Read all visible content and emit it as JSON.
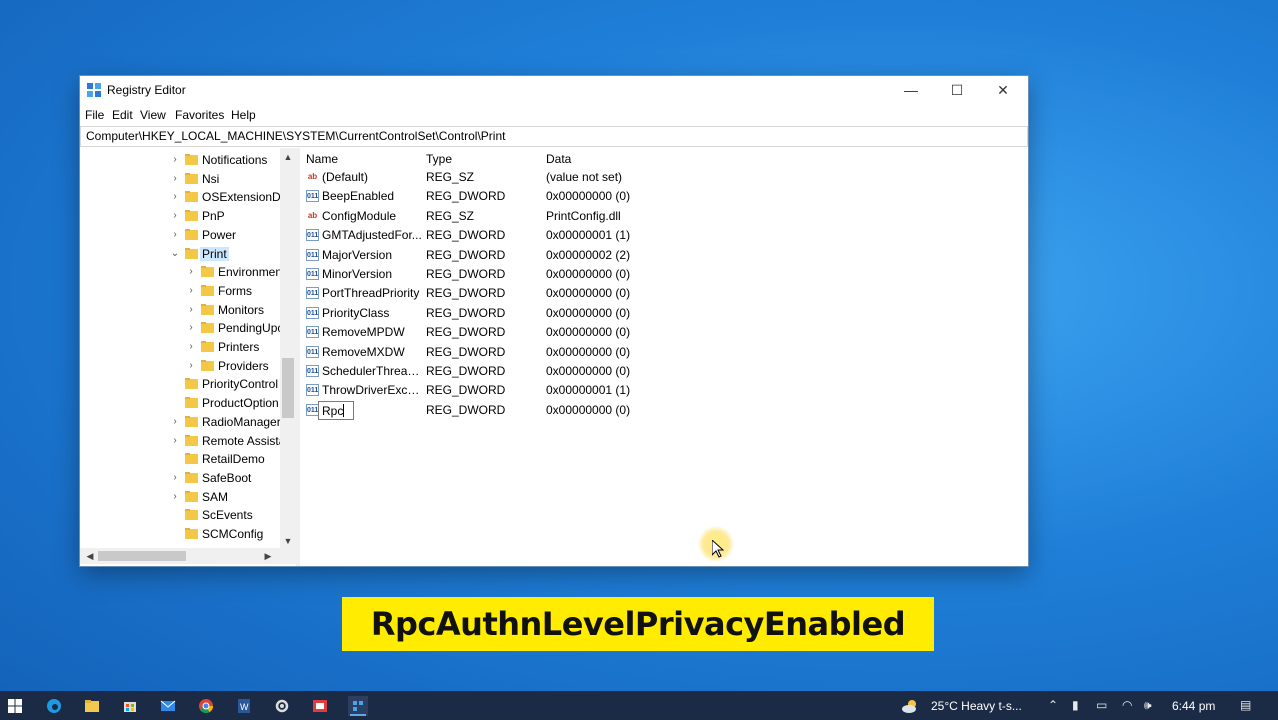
{
  "window": {
    "title": "Registry Editor",
    "controls": {
      "minimize": "—",
      "maximize": "☐",
      "close": "✕"
    }
  },
  "menu": [
    "File",
    "Edit",
    "View",
    "Favorites",
    "Help"
  ],
  "address": "Computer\\HKEY_LOCAL_MACHINE\\SYSTEM\\CurrentControlSet\\Control\\Print",
  "tree": [
    {
      "label": "Notifications",
      "expandable": true,
      "level": 0
    },
    {
      "label": "Nsi",
      "expandable": true,
      "level": 0
    },
    {
      "label": "OSExtensionDa",
      "expandable": true,
      "level": 0
    },
    {
      "label": "PnP",
      "expandable": true,
      "level": 0
    },
    {
      "label": "Power",
      "expandable": true,
      "level": 0
    },
    {
      "label": "Print",
      "expandable": true,
      "expanded": true,
      "selected": true,
      "level": 0
    },
    {
      "label": "Environmen",
      "expandable": true,
      "level": 1
    },
    {
      "label": "Forms",
      "expandable": true,
      "level": 1
    },
    {
      "label": "Monitors",
      "expandable": true,
      "level": 1
    },
    {
      "label": "PendingUpc",
      "expandable": true,
      "level": 1
    },
    {
      "label": "Printers",
      "expandable": true,
      "level": 1
    },
    {
      "label": "Providers",
      "expandable": true,
      "level": 1
    },
    {
      "label": "PriorityControl",
      "expandable": false,
      "level": 0
    },
    {
      "label": "ProductOption",
      "expandable": false,
      "level": 0
    },
    {
      "label": "RadioManager",
      "expandable": true,
      "level": 0
    },
    {
      "label": "Remote Assista",
      "expandable": true,
      "level": 0
    },
    {
      "label": "RetailDemo",
      "expandable": false,
      "level": 0
    },
    {
      "label": "SafeBoot",
      "expandable": true,
      "level": 0
    },
    {
      "label": "SAM",
      "expandable": true,
      "level": 0
    },
    {
      "label": "ScEvents",
      "expandable": false,
      "level": 0
    },
    {
      "label": "SCMConfig",
      "expandable": false,
      "level": 0
    }
  ],
  "columns": {
    "name": "Name",
    "type": "Type",
    "data": "Data"
  },
  "values": [
    {
      "icon": "ab",
      "name": "(Default)",
      "type": "REG_SZ",
      "data": "(value not set)"
    },
    {
      "icon": "dw",
      "name": "BeepEnabled",
      "type": "REG_DWORD",
      "data": "0x00000000 (0)"
    },
    {
      "icon": "ab",
      "name": "ConfigModule",
      "type": "REG_SZ",
      "data": "PrintConfig.dll"
    },
    {
      "icon": "dw",
      "name": "GMTAdjustedFor...",
      "type": "REG_DWORD",
      "data": "0x00000001 (1)"
    },
    {
      "icon": "dw",
      "name": "MajorVersion",
      "type": "REG_DWORD",
      "data": "0x00000002 (2)"
    },
    {
      "icon": "dw",
      "name": "MinorVersion",
      "type": "REG_DWORD",
      "data": "0x00000000 (0)"
    },
    {
      "icon": "dw",
      "name": "PortThreadPriority",
      "type": "REG_DWORD",
      "data": "0x00000000 (0)"
    },
    {
      "icon": "dw",
      "name": "PriorityClass",
      "type": "REG_DWORD",
      "data": "0x00000000 (0)"
    },
    {
      "icon": "dw",
      "name": "RemoveMPDW",
      "type": "REG_DWORD",
      "data": "0x00000000 (0)"
    },
    {
      "icon": "dw",
      "name": "RemoveMXDW",
      "type": "REG_DWORD",
      "data": "0x00000000 (0)"
    },
    {
      "icon": "dw",
      "name": "SchedulerThread...",
      "type": "REG_DWORD",
      "data": "0x00000000 (0)"
    },
    {
      "icon": "dw",
      "name": "ThrowDriverExce...",
      "type": "REG_DWORD",
      "data": "0x00000001 (1)"
    },
    {
      "icon": "dw",
      "name": "Rpc",
      "type": "REG_DWORD",
      "data": "0x00000000 (0)",
      "editing": true
    }
  ],
  "banner": "RpcAuthnLevelPrivacyEnabled",
  "taskbar": {
    "weather": "25°C  Heavy t-s...",
    "time": "6:44 pm"
  },
  "colors": {
    "accent": "#0078d7",
    "banner": "#ffec00",
    "taskbar": "#1b2a45"
  }
}
